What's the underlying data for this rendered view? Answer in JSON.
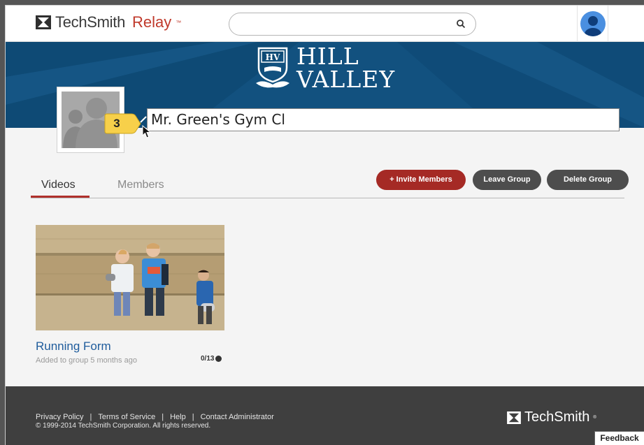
{
  "header": {
    "brand": "TechSmith",
    "product": "Relay",
    "trademark": "™",
    "search_placeholder": ""
  },
  "banner": {
    "org_line1": "HILL",
    "org_line2": "VALLEY",
    "crest_text": "HV"
  },
  "group": {
    "name_value": "Mr. Green's Gym Cl",
    "callout_number": "3"
  },
  "tabs": [
    {
      "label": "Videos",
      "active": true
    },
    {
      "label": "Members",
      "active": false
    }
  ],
  "actions": {
    "invite": "+ Invite Members",
    "leave": "Leave Group",
    "delete": "Delete Group"
  },
  "videos": [
    {
      "title": "Running Form",
      "meta": "Added to group 5 months ago",
      "count": "0/13"
    }
  ],
  "footer": {
    "links": [
      "Privacy Policy",
      "Terms of Service",
      "Help",
      "Contact Administrator"
    ],
    "copyright": "© 1999-2014 TechSmith Corporation. All rights reserved.",
    "brand": "TechSmith",
    "trademark": "®",
    "feedback": "Feedback"
  },
  "colors": {
    "accent": "#a52a25",
    "banner": "#12517f",
    "link": "#1f5c9c",
    "footer": "#3f3f3f"
  }
}
